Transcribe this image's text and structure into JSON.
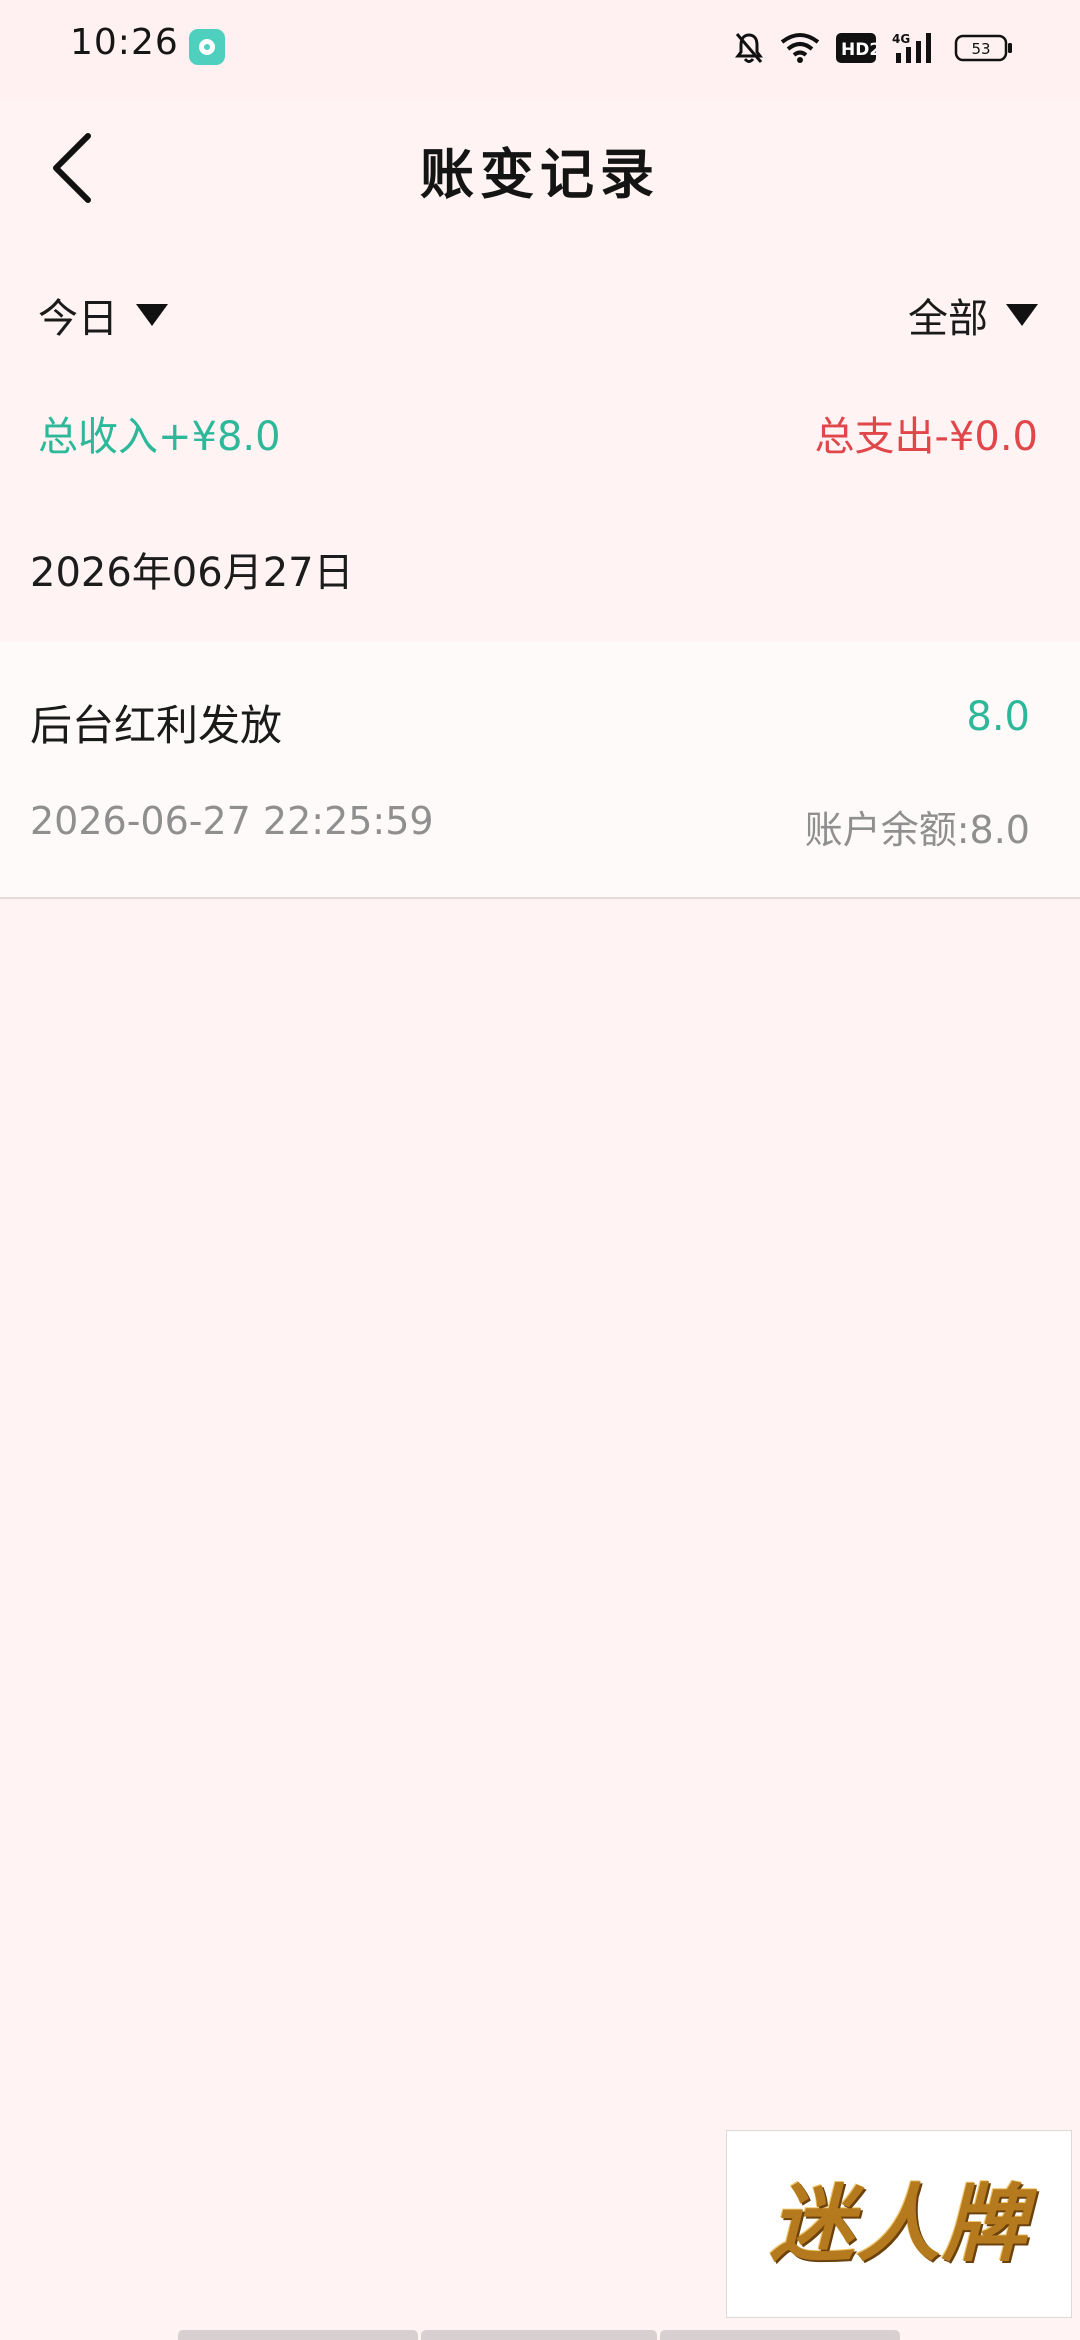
{
  "status_bar": {
    "time": "10:26",
    "battery": "53",
    "network": "4G",
    "hd_badge": "HD2",
    "icons": [
      "app-notification-icon",
      "mute-bell-icon",
      "wifi-icon",
      "hd-icon",
      "signal-icon",
      "battery-icon"
    ]
  },
  "header": {
    "title": "账变记录",
    "back_icon": "chevron-left-icon"
  },
  "filters": {
    "period": "今日",
    "type": "全部"
  },
  "totals": {
    "income": "总收入+¥8.0",
    "expense": "总支出-¥0.0",
    "income_color": "#2db89a",
    "expense_color": "#e0474a"
  },
  "records": [
    {
      "date": "2026年06月27日",
      "title": "后台红利发放",
      "amount": "8.0",
      "time": "2026-06-27 22:25:59",
      "balance": "账户余额:8.0"
    }
  ],
  "logo": {
    "text": "迷人牌"
  }
}
